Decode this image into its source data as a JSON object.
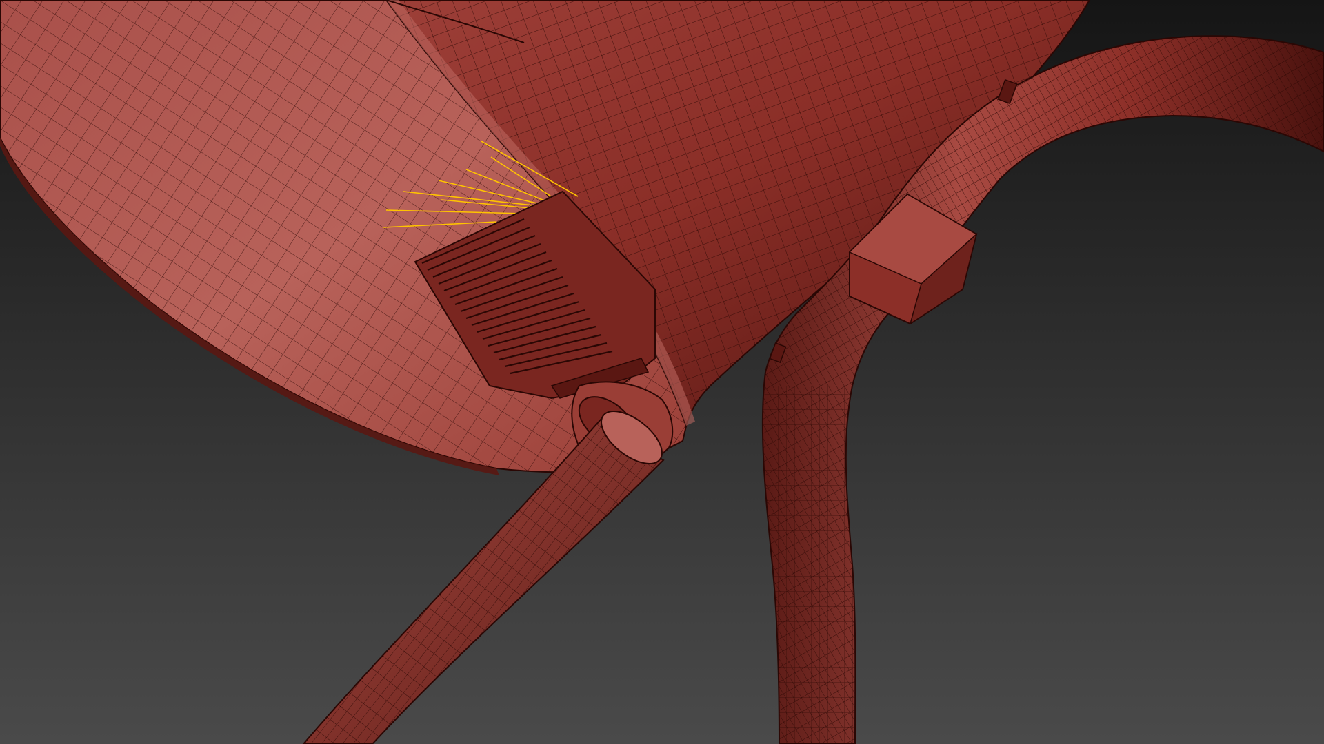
{
  "viewport": {
    "background_top": "#151515",
    "background_bottom": "#4a4a4a"
  },
  "scene": {
    "mesh_color": "#a1453c",
    "mesh_color_light": "#b8625a",
    "mesh_color_dark": "#4f1410",
    "wire_color": "#2a0704",
    "light_ray_color": "#ffc400"
  }
}
